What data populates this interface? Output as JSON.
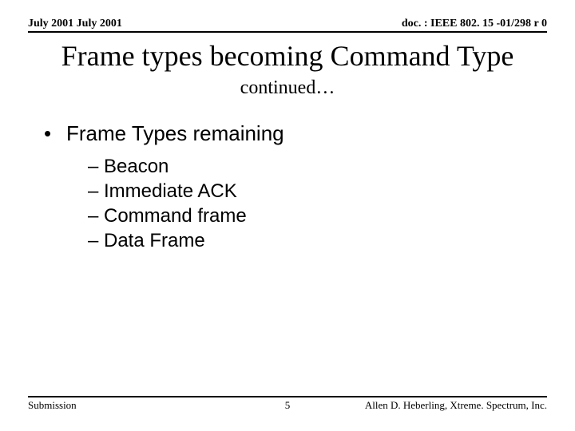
{
  "header": {
    "left": "July 2001 July 2001",
    "right": "doc. : IEEE 802. 15 -01/298 r 0"
  },
  "title": "Frame types becoming Command Type",
  "subtitle": "continued…",
  "main_bullet": "Frame Types remaining",
  "sub_items": {
    "0": "Beacon",
    "1": "Immediate ACK",
    "2": "Command frame",
    "3": "Data Frame"
  },
  "footer": {
    "left": "Submission",
    "center": "5",
    "right": "Allen D. Heberling, Xtreme. Spectrum, Inc."
  }
}
